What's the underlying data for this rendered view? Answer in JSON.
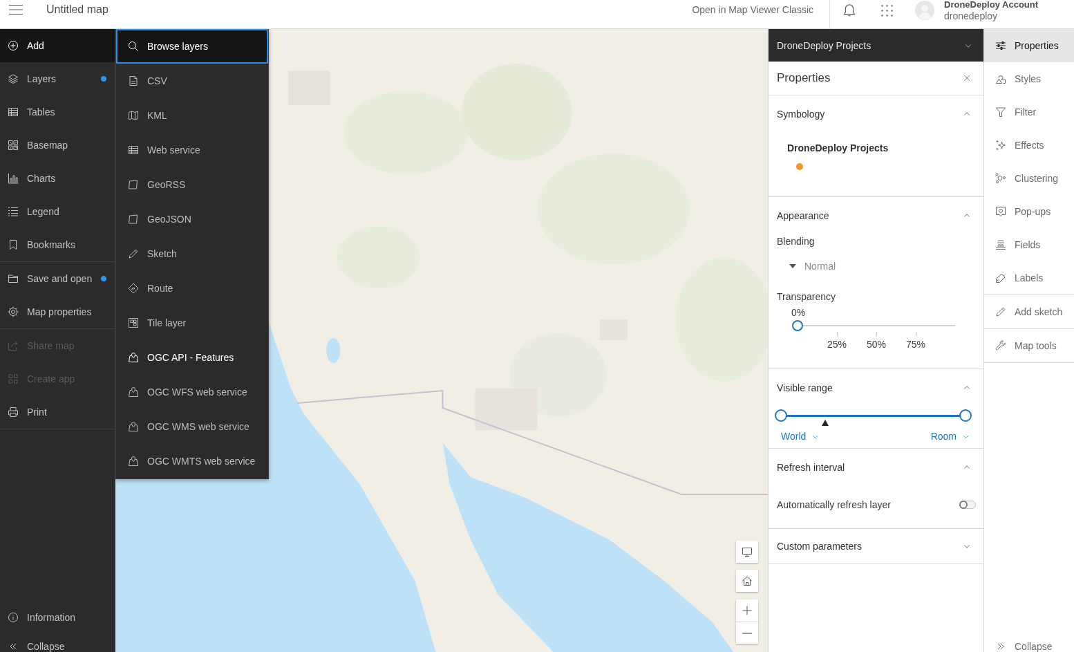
{
  "header": {
    "title": "Untitled map",
    "classic_link": "Open in Map Viewer Classic",
    "account": {
      "name": "DroneDeploy Account",
      "username": "dronedeploy"
    }
  },
  "left_toolbar": {
    "groups": [
      {
        "items": [
          {
            "label": "Add",
            "selected": true,
            "disabled": false,
            "indicator": false
          },
          {
            "label": "Layers",
            "selected": false,
            "disabled": false,
            "indicator": true
          },
          {
            "label": "Tables",
            "selected": false,
            "disabled": false,
            "indicator": false
          },
          {
            "label": "Basemap",
            "selected": false,
            "disabled": false,
            "indicator": false
          },
          {
            "label": "Charts",
            "selected": false,
            "disabled": false,
            "indicator": false
          },
          {
            "label": "Legend",
            "selected": false,
            "disabled": false,
            "indicator": false
          },
          {
            "label": "Bookmarks",
            "selected": false,
            "disabled": false,
            "indicator": false
          }
        ]
      },
      {
        "items": [
          {
            "label": "Save and open",
            "selected": false,
            "disabled": false,
            "indicator": true
          },
          {
            "label": "Map properties",
            "selected": false,
            "disabled": false,
            "indicator": false
          }
        ]
      },
      {
        "items": [
          {
            "label": "Share map",
            "selected": false,
            "disabled": true,
            "indicator": false
          },
          {
            "label": "Create app",
            "selected": false,
            "disabled": true,
            "indicator": false
          },
          {
            "label": "Print",
            "selected": false,
            "disabled": false,
            "indicator": false
          }
        ]
      }
    ],
    "footer": [
      {
        "label": "Information"
      },
      {
        "label": "Collapse"
      }
    ]
  },
  "add_menu": {
    "items": [
      {
        "label": "Browse layers",
        "focused": true,
        "hovered": false
      },
      {
        "label": "CSV",
        "focused": false,
        "hovered": false
      },
      {
        "label": "KML",
        "focused": false,
        "hovered": false
      },
      {
        "label": "Web service",
        "focused": false,
        "hovered": false
      },
      {
        "label": "GeoRSS",
        "focused": false,
        "hovered": false
      },
      {
        "label": "GeoJSON",
        "focused": false,
        "hovered": false
      },
      {
        "label": "Sketch",
        "focused": false,
        "hovered": false
      },
      {
        "label": "Route",
        "focused": false,
        "hovered": false
      },
      {
        "label": "Tile layer",
        "focused": false,
        "hovered": false
      },
      {
        "label": "OGC API - Features",
        "focused": false,
        "hovered": true
      },
      {
        "label": "OGC WFS web service",
        "focused": false,
        "hovered": false
      },
      {
        "label": "OGC WMS web service",
        "focused": false,
        "hovered": false
      },
      {
        "label": "OGC WMTS web service",
        "focused": false,
        "hovered": false
      }
    ]
  },
  "layer_panel": {
    "layer_picker": "DroneDeploy Projects",
    "title": "Properties",
    "sections": [
      {
        "kind": "symbology",
        "title": "Symbology",
        "expanded": true,
        "layer_name": "DroneDeploy Projects",
        "symbol": {
          "color": "#f5922b"
        }
      },
      {
        "kind": "appearance",
        "title": "Appearance",
        "expanded": true,
        "blending": {
          "label": "Blending",
          "value": "Normal"
        },
        "transparency": {
          "label": "Transparency",
          "reading": "0%",
          "level": 0,
          "ticks": [
            "25%",
            "50%",
            "75%"
          ]
        }
      },
      {
        "kind": "visible_range",
        "title": "Visible range",
        "expanded": true,
        "min_thumb": {
          "level": 0
        },
        "max_thumb": {
          "level": 1
        },
        "current_scale": {
          "level": 0.24
        },
        "min_label": "World",
        "max_label": "Room"
      },
      {
        "kind": "refresh",
        "title": "Refresh interval",
        "expanded": true,
        "option": {
          "label": "Automatically refresh layer",
          "on": false
        }
      },
      {
        "kind": "custom_parameters",
        "title": "Custom parameters",
        "expanded": false
      }
    ]
  },
  "right_toolbar": {
    "groups": [
      {
        "items": [
          {
            "label": "Properties",
            "selected": true
          },
          {
            "label": "Styles",
            "selected": false
          },
          {
            "label": "Filter",
            "selected": false
          },
          {
            "label": "Effects",
            "selected": false
          },
          {
            "label": "Clustering",
            "selected": false
          },
          {
            "label": "Pop-ups",
            "selected": false
          },
          {
            "label": "Fields",
            "selected": false
          },
          {
            "label": "Labels",
            "selected": false
          }
        ]
      },
      {
        "items": [
          {
            "label": "Add sketch",
            "selected": false
          }
        ]
      },
      {
        "items": [
          {
            "label": "Map tools",
            "selected": false
          }
        ]
      }
    ],
    "footer": {
      "label": "Collapse"
    }
  }
}
